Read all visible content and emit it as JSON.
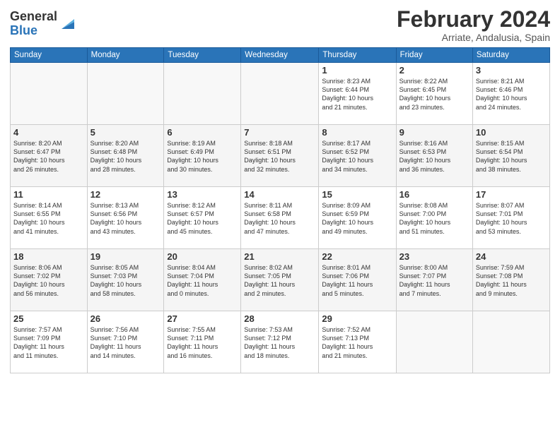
{
  "logo": {
    "general": "General",
    "blue": "Blue"
  },
  "header": {
    "month": "February 2024",
    "location": "Arriate, Andalusia, Spain"
  },
  "days_of_week": [
    "Sunday",
    "Monday",
    "Tuesday",
    "Wednesday",
    "Thursday",
    "Friday",
    "Saturday"
  ],
  "weeks": [
    [
      {
        "day": "",
        "info": ""
      },
      {
        "day": "",
        "info": ""
      },
      {
        "day": "",
        "info": ""
      },
      {
        "day": "",
        "info": ""
      },
      {
        "day": "1",
        "info": "Sunrise: 8:23 AM\nSunset: 6:44 PM\nDaylight: 10 hours\nand 21 minutes."
      },
      {
        "day": "2",
        "info": "Sunrise: 8:22 AM\nSunset: 6:45 PM\nDaylight: 10 hours\nand 23 minutes."
      },
      {
        "day": "3",
        "info": "Sunrise: 8:21 AM\nSunset: 6:46 PM\nDaylight: 10 hours\nand 24 minutes."
      }
    ],
    [
      {
        "day": "4",
        "info": "Sunrise: 8:20 AM\nSunset: 6:47 PM\nDaylight: 10 hours\nand 26 minutes."
      },
      {
        "day": "5",
        "info": "Sunrise: 8:20 AM\nSunset: 6:48 PM\nDaylight: 10 hours\nand 28 minutes."
      },
      {
        "day": "6",
        "info": "Sunrise: 8:19 AM\nSunset: 6:49 PM\nDaylight: 10 hours\nand 30 minutes."
      },
      {
        "day": "7",
        "info": "Sunrise: 8:18 AM\nSunset: 6:51 PM\nDaylight: 10 hours\nand 32 minutes."
      },
      {
        "day": "8",
        "info": "Sunrise: 8:17 AM\nSunset: 6:52 PM\nDaylight: 10 hours\nand 34 minutes."
      },
      {
        "day": "9",
        "info": "Sunrise: 8:16 AM\nSunset: 6:53 PM\nDaylight: 10 hours\nand 36 minutes."
      },
      {
        "day": "10",
        "info": "Sunrise: 8:15 AM\nSunset: 6:54 PM\nDaylight: 10 hours\nand 38 minutes."
      }
    ],
    [
      {
        "day": "11",
        "info": "Sunrise: 8:14 AM\nSunset: 6:55 PM\nDaylight: 10 hours\nand 41 minutes."
      },
      {
        "day": "12",
        "info": "Sunrise: 8:13 AM\nSunset: 6:56 PM\nDaylight: 10 hours\nand 43 minutes."
      },
      {
        "day": "13",
        "info": "Sunrise: 8:12 AM\nSunset: 6:57 PM\nDaylight: 10 hours\nand 45 minutes."
      },
      {
        "day": "14",
        "info": "Sunrise: 8:11 AM\nSunset: 6:58 PM\nDaylight: 10 hours\nand 47 minutes."
      },
      {
        "day": "15",
        "info": "Sunrise: 8:09 AM\nSunset: 6:59 PM\nDaylight: 10 hours\nand 49 minutes."
      },
      {
        "day": "16",
        "info": "Sunrise: 8:08 AM\nSunset: 7:00 PM\nDaylight: 10 hours\nand 51 minutes."
      },
      {
        "day": "17",
        "info": "Sunrise: 8:07 AM\nSunset: 7:01 PM\nDaylight: 10 hours\nand 53 minutes."
      }
    ],
    [
      {
        "day": "18",
        "info": "Sunrise: 8:06 AM\nSunset: 7:02 PM\nDaylight: 10 hours\nand 56 minutes."
      },
      {
        "day": "19",
        "info": "Sunrise: 8:05 AM\nSunset: 7:03 PM\nDaylight: 10 hours\nand 58 minutes."
      },
      {
        "day": "20",
        "info": "Sunrise: 8:04 AM\nSunset: 7:04 PM\nDaylight: 11 hours\nand 0 minutes."
      },
      {
        "day": "21",
        "info": "Sunrise: 8:02 AM\nSunset: 7:05 PM\nDaylight: 11 hours\nand 2 minutes."
      },
      {
        "day": "22",
        "info": "Sunrise: 8:01 AM\nSunset: 7:06 PM\nDaylight: 11 hours\nand 5 minutes."
      },
      {
        "day": "23",
        "info": "Sunrise: 8:00 AM\nSunset: 7:07 PM\nDaylight: 11 hours\nand 7 minutes."
      },
      {
        "day": "24",
        "info": "Sunrise: 7:59 AM\nSunset: 7:08 PM\nDaylight: 11 hours\nand 9 minutes."
      }
    ],
    [
      {
        "day": "25",
        "info": "Sunrise: 7:57 AM\nSunset: 7:09 PM\nDaylight: 11 hours\nand 11 minutes."
      },
      {
        "day": "26",
        "info": "Sunrise: 7:56 AM\nSunset: 7:10 PM\nDaylight: 11 hours\nand 14 minutes."
      },
      {
        "day": "27",
        "info": "Sunrise: 7:55 AM\nSunset: 7:11 PM\nDaylight: 11 hours\nand 16 minutes."
      },
      {
        "day": "28",
        "info": "Sunrise: 7:53 AM\nSunset: 7:12 PM\nDaylight: 11 hours\nand 18 minutes."
      },
      {
        "day": "29",
        "info": "Sunrise: 7:52 AM\nSunset: 7:13 PM\nDaylight: 11 hours\nand 21 minutes."
      },
      {
        "day": "",
        "info": ""
      },
      {
        "day": "",
        "info": ""
      }
    ]
  ]
}
